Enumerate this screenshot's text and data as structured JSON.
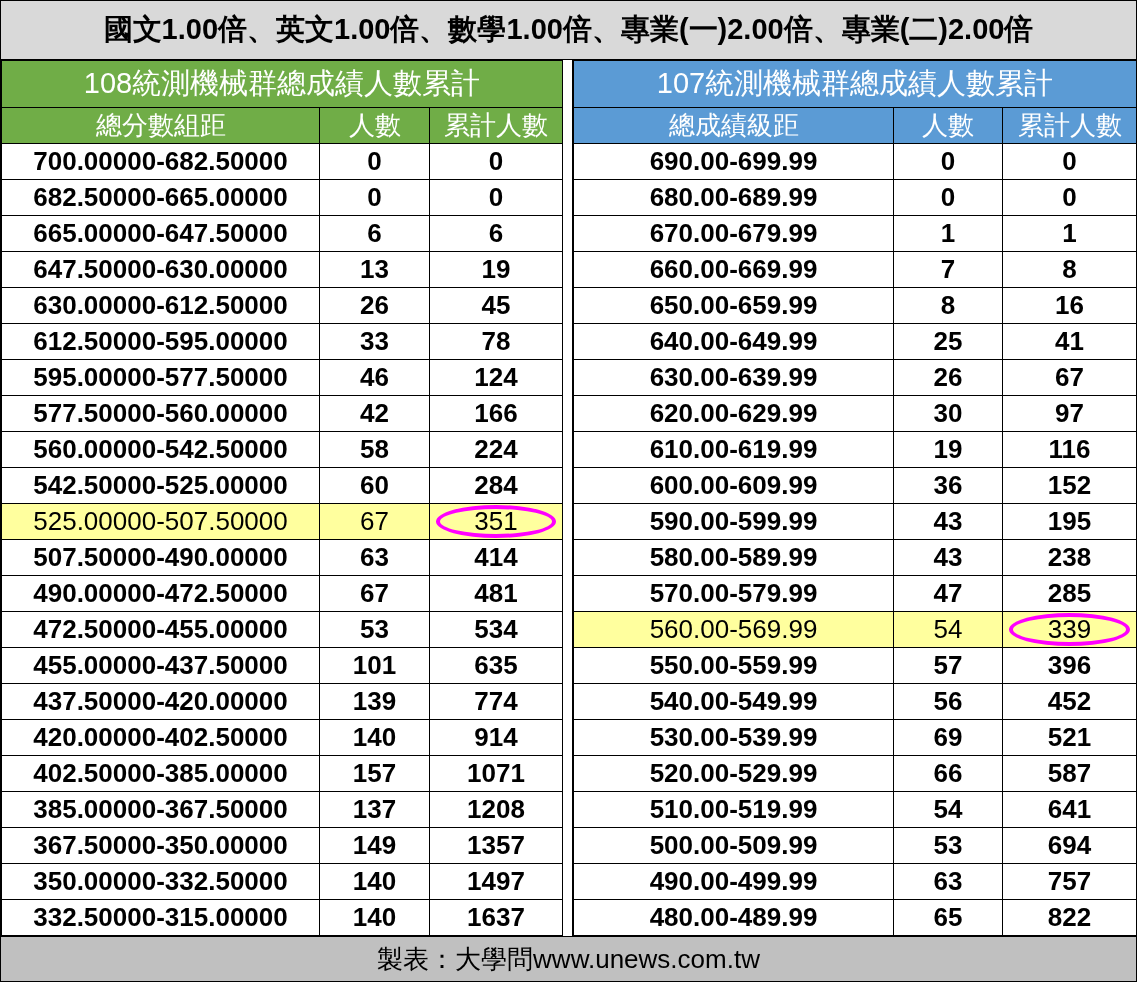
{
  "title": "國文1.00倍、英文1.00倍、數學1.00倍、專業(一)2.00倍、專業(二)2.00倍",
  "tables": [
    {
      "heading": "108統測機械群總成績人數累計",
      "color": "#70ad47",
      "columns": [
        "總分數組距",
        "人數",
        "累計人數"
      ],
      "rows": [
        {
          "cells": [
            "700.00000-682.50000",
            "0",
            "0"
          ],
          "highlighted": false,
          "circled": false
        },
        {
          "cells": [
            "682.50000-665.00000",
            "0",
            "0"
          ],
          "highlighted": false,
          "circled": false
        },
        {
          "cells": [
            "665.00000-647.50000",
            "6",
            "6"
          ],
          "highlighted": false,
          "circled": false
        },
        {
          "cells": [
            "647.50000-630.00000",
            "13",
            "19"
          ],
          "highlighted": false,
          "circled": false
        },
        {
          "cells": [
            "630.00000-612.50000",
            "26",
            "45"
          ],
          "highlighted": false,
          "circled": false
        },
        {
          "cells": [
            "612.50000-595.00000",
            "33",
            "78"
          ],
          "highlighted": false,
          "circled": false
        },
        {
          "cells": [
            "595.00000-577.50000",
            "46",
            "124"
          ],
          "highlighted": false,
          "circled": false
        },
        {
          "cells": [
            "577.50000-560.00000",
            "42",
            "166"
          ],
          "highlighted": false,
          "circled": false
        },
        {
          "cells": [
            "560.00000-542.50000",
            "58",
            "224"
          ],
          "highlighted": false,
          "circled": false
        },
        {
          "cells": [
            "542.50000-525.00000",
            "60",
            "284"
          ],
          "highlighted": false,
          "circled": false
        },
        {
          "cells": [
            "525.00000-507.50000",
            "67",
            "351"
          ],
          "highlighted": true,
          "circled": true
        },
        {
          "cells": [
            "507.50000-490.00000",
            "63",
            "414"
          ],
          "highlighted": false,
          "circled": false
        },
        {
          "cells": [
            "490.00000-472.50000",
            "67",
            "481"
          ],
          "highlighted": false,
          "circled": false
        },
        {
          "cells": [
            "472.50000-455.00000",
            "53",
            "534"
          ],
          "highlighted": false,
          "circled": false
        },
        {
          "cells": [
            "455.00000-437.50000",
            "101",
            "635"
          ],
          "highlighted": false,
          "circled": false
        },
        {
          "cells": [
            "437.50000-420.00000",
            "139",
            "774"
          ],
          "highlighted": false,
          "circled": false
        },
        {
          "cells": [
            "420.00000-402.50000",
            "140",
            "914"
          ],
          "highlighted": false,
          "circled": false
        },
        {
          "cells": [
            "402.50000-385.00000",
            "157",
            "1071"
          ],
          "highlighted": false,
          "circled": false
        },
        {
          "cells": [
            "385.00000-367.50000",
            "137",
            "1208"
          ],
          "highlighted": false,
          "circled": false
        },
        {
          "cells": [
            "367.50000-350.00000",
            "149",
            "1357"
          ],
          "highlighted": false,
          "circled": false
        },
        {
          "cells": [
            "350.00000-332.50000",
            "140",
            "1497"
          ],
          "highlighted": false,
          "circled": false
        },
        {
          "cells": [
            "332.50000-315.00000",
            "140",
            "1637"
          ],
          "highlighted": false,
          "circled": false
        }
      ]
    },
    {
      "heading": "107統測機械群總成績人數累計",
      "color": "#5b9bd5",
      "columns": [
        "總成績級距",
        "人數",
        "累計人數"
      ],
      "rows": [
        {
          "cells": [
            "690.00-699.99",
            "0",
            "0"
          ],
          "highlighted": false,
          "circled": false
        },
        {
          "cells": [
            "680.00-689.99",
            "0",
            "0"
          ],
          "highlighted": false,
          "circled": false
        },
        {
          "cells": [
            "670.00-679.99",
            "1",
            "1"
          ],
          "highlighted": false,
          "circled": false
        },
        {
          "cells": [
            "660.00-669.99",
            "7",
            "8"
          ],
          "highlighted": false,
          "circled": false
        },
        {
          "cells": [
            "650.00-659.99",
            "8",
            "16"
          ],
          "highlighted": false,
          "circled": false
        },
        {
          "cells": [
            "640.00-649.99",
            "25",
            "41"
          ],
          "highlighted": false,
          "circled": false
        },
        {
          "cells": [
            "630.00-639.99",
            "26",
            "67"
          ],
          "highlighted": false,
          "circled": false
        },
        {
          "cells": [
            "620.00-629.99",
            "30",
            "97"
          ],
          "highlighted": false,
          "circled": false
        },
        {
          "cells": [
            "610.00-619.99",
            "19",
            "116"
          ],
          "highlighted": false,
          "circled": false
        },
        {
          "cells": [
            "600.00-609.99",
            "36",
            "152"
          ],
          "highlighted": false,
          "circled": false
        },
        {
          "cells": [
            "590.00-599.99",
            "43",
            "195"
          ],
          "highlighted": false,
          "circled": false
        },
        {
          "cells": [
            "580.00-589.99",
            "43",
            "238"
          ],
          "highlighted": false,
          "circled": false
        },
        {
          "cells": [
            "570.00-579.99",
            "47",
            "285"
          ],
          "highlighted": false,
          "circled": false
        },
        {
          "cells": [
            "560.00-569.99",
            "54",
            "339"
          ],
          "highlighted": true,
          "circled": true
        },
        {
          "cells": [
            "550.00-559.99",
            "57",
            "396"
          ],
          "highlighted": false,
          "circled": false
        },
        {
          "cells": [
            "540.00-549.99",
            "56",
            "452"
          ],
          "highlighted": false,
          "circled": false
        },
        {
          "cells": [
            "530.00-539.99",
            "69",
            "521"
          ],
          "highlighted": false,
          "circled": false
        },
        {
          "cells": [
            "520.00-529.99",
            "66",
            "587"
          ],
          "highlighted": false,
          "circled": false
        },
        {
          "cells": [
            "510.00-519.99",
            "54",
            "641"
          ],
          "highlighted": false,
          "circled": false
        },
        {
          "cells": [
            "500.00-509.99",
            "53",
            "694"
          ],
          "highlighted": false,
          "circled": false
        },
        {
          "cells": [
            "490.00-499.99",
            "63",
            "757"
          ],
          "highlighted": false,
          "circled": false
        },
        {
          "cells": [
            "480.00-489.99",
            "65",
            "822"
          ],
          "highlighted": false,
          "circled": false
        }
      ]
    }
  ],
  "footer": "製表：大學問www.unews.com.tw"
}
